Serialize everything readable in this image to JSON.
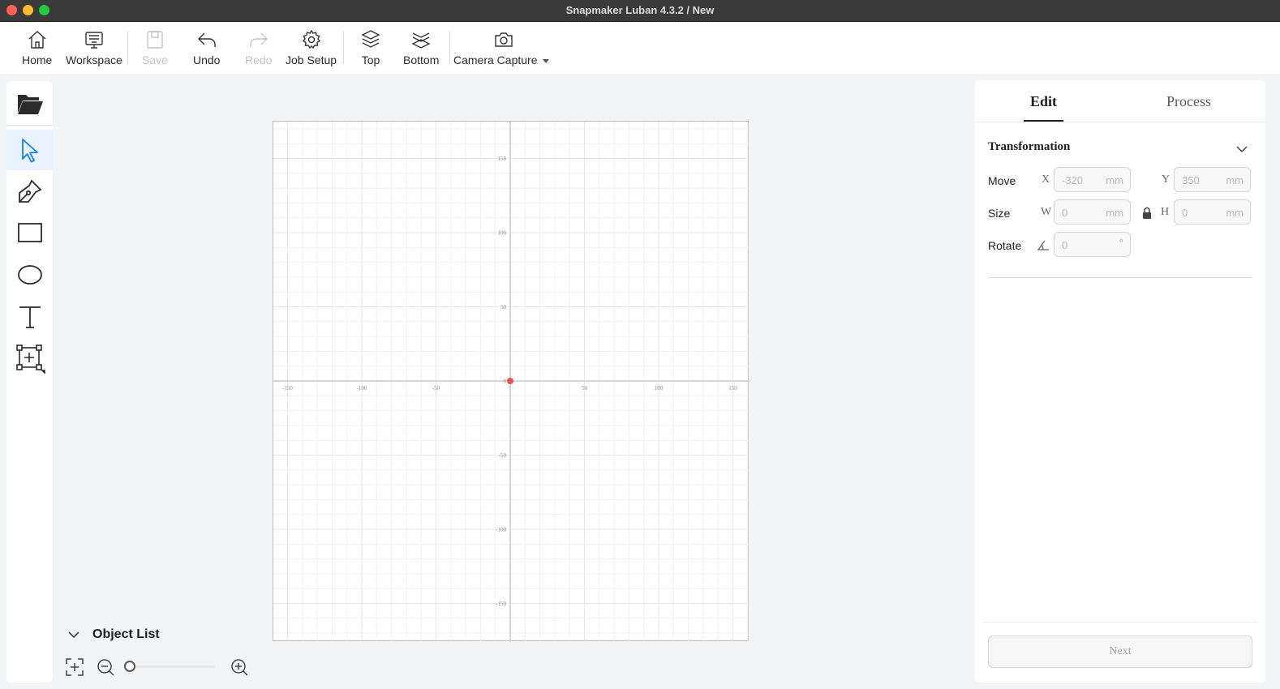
{
  "window": {
    "title": "Snapmaker Luban 4.3.2 / New"
  },
  "toolbar": {
    "home": "Home",
    "workspace": "Workspace",
    "save": "Save",
    "undo": "Undo",
    "redo": "Redo",
    "job_setup": "Job Setup",
    "top": "Top",
    "bottom": "Bottom",
    "camera_capture": "Camera Capture"
  },
  "left_tools": [
    "folder-open-icon",
    "select-arrow-icon",
    "pen-icon",
    "rectangle-icon",
    "ellipse-icon",
    "text-icon",
    "add-frame-icon"
  ],
  "canvas": {
    "x_ticks": [
      "-150",
      "-100",
      "-50",
      "50",
      "100",
      "150"
    ],
    "y_ticks": [
      "150",
      "100",
      "50",
      "0",
      "-50",
      "-100",
      "-150"
    ],
    "origin_color": "#e8534a"
  },
  "object_list": {
    "label": "Object List"
  },
  "panel": {
    "tabs": {
      "edit": "Edit",
      "process": "Process"
    },
    "transformation": {
      "title": "Transformation",
      "move_label": "Move",
      "size_label": "Size",
      "rotate_label": "Rotate",
      "x_axis": "X",
      "y_axis": "Y",
      "w_axis": "W",
      "h_axis": "H",
      "x_value": "-320",
      "y_value": "350",
      "w_value": "0",
      "h_value": "0",
      "rotate_value": "0",
      "unit_mm": "mm",
      "unit_deg": "°"
    },
    "next_label": "Next"
  }
}
